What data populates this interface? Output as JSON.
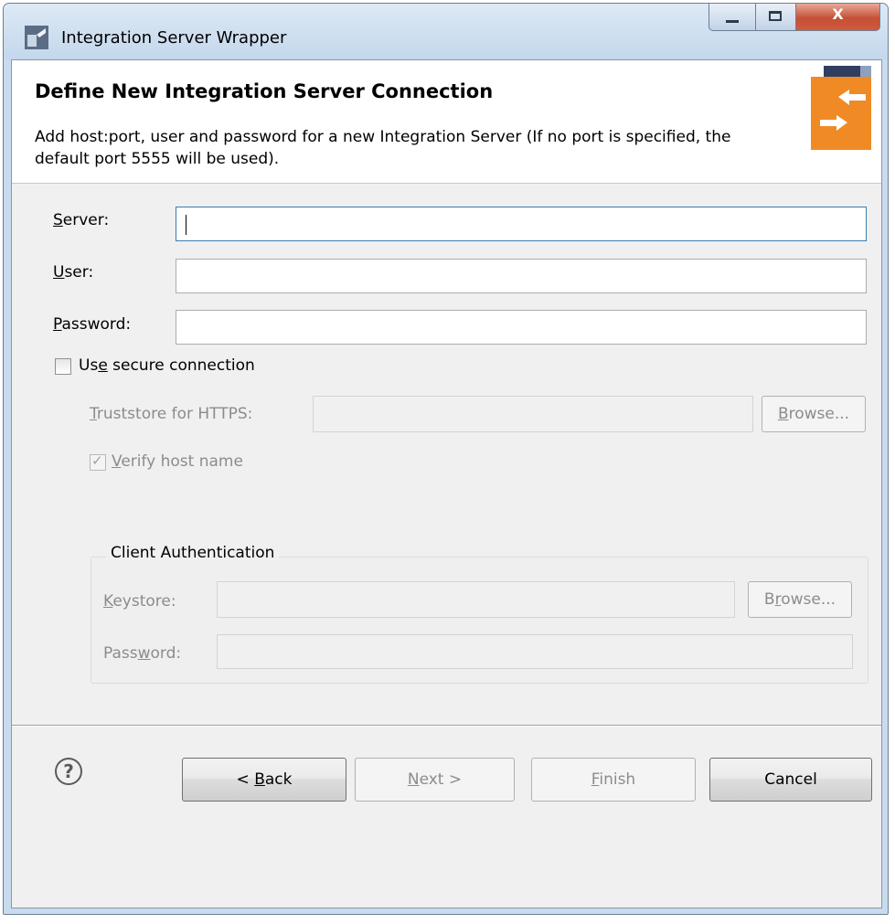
{
  "window": {
    "title": "Integration Server Wrapper",
    "controls": {
      "minimize": "–",
      "maximize": "□",
      "close": "X"
    }
  },
  "header": {
    "title": "Define New Integration Server Connection",
    "description": "Add host:port, user and password for a new Integration Server (If no port is specified, the default port 5555 will be used)."
  },
  "form": {
    "server": {
      "label_pre": "",
      "label_mn": "S",
      "label_post": "erver:",
      "value": ""
    },
    "user": {
      "label_pre": "",
      "label_mn": "U",
      "label_post": "ser:",
      "value": ""
    },
    "password": {
      "label_pre": "",
      "label_mn": "P",
      "label_post": "assword:",
      "value": ""
    },
    "secure": {
      "label_pre": "Us",
      "label_mn": "e",
      "label_post": " secure connection",
      "checked": false
    },
    "truststore": {
      "label_pre": "",
      "label_mn": "T",
      "label_post": "ruststore for HTTPS:",
      "value": "",
      "enabled": false
    },
    "truststore_browse": {
      "pre": "",
      "mn": "B",
      "post": "rowse...",
      "enabled": false
    },
    "verify_host": {
      "label_pre": "",
      "label_mn": "V",
      "label_post": "erify host name",
      "checked": true,
      "enabled": false
    },
    "client_auth": {
      "title": "Client Authentication",
      "keystore": {
        "label_pre": "",
        "label_mn": "K",
        "label_post": "eystore:",
        "value": "",
        "enabled": false
      },
      "keystore_browse": {
        "pre": "B",
        "mn": "r",
        "post": "owse...",
        "enabled": false
      },
      "password": {
        "label_pre": "Pass",
        "label_mn": "w",
        "label_post": "ord:",
        "value": "",
        "enabled": false
      }
    }
  },
  "footer": {
    "help_icon": "?",
    "back": {
      "pre": "< ",
      "mn": "B",
      "post": "ack",
      "enabled": true
    },
    "next": {
      "pre": "",
      "mn": "N",
      "post": "ext >",
      "enabled": false
    },
    "finish": {
      "pre": "",
      "mn": "F",
      "post": "inish",
      "enabled": false
    },
    "cancel": {
      "label": "Cancel",
      "enabled": true
    }
  }
}
